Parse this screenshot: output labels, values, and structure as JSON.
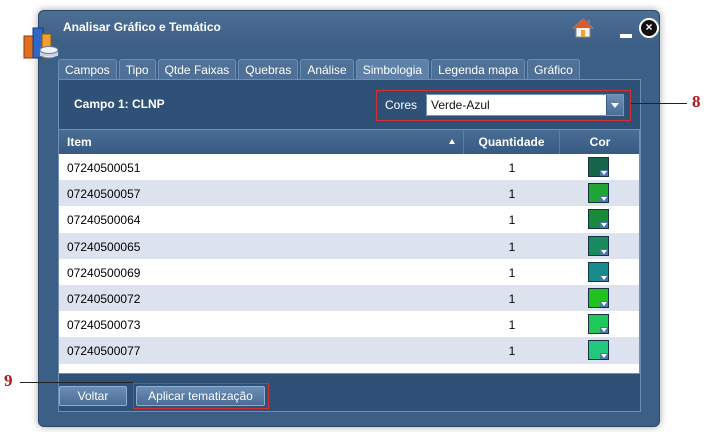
{
  "window": {
    "title": "Analisar Gráfico e Temático"
  },
  "tabs": [
    {
      "label": "Campos"
    },
    {
      "label": "Tipo"
    },
    {
      "label": "Qtde Faixas"
    },
    {
      "label": "Quebras"
    },
    {
      "label": "Análise"
    },
    {
      "label": "Simbologia",
      "active": true
    },
    {
      "label": "Legenda mapa"
    },
    {
      "label": "Gráfico"
    }
  ],
  "field": {
    "label": "Campo 1: CLNP"
  },
  "cores": {
    "label": "Cores",
    "value": "Verde-Azul"
  },
  "grid": {
    "headers": {
      "item": "Item",
      "quantidade": "Quantidade",
      "cor": "Cor"
    },
    "rows": [
      {
        "item": "07240500051",
        "quantidade": "1",
        "color": "#17664a"
      },
      {
        "item": "07240500057",
        "quantidade": "1",
        "color": "#1ea534"
      },
      {
        "item": "07240500064",
        "quantidade": "1",
        "color": "#1a8a3a"
      },
      {
        "item": "07240500065",
        "quantidade": "1",
        "color": "#188a5e"
      },
      {
        "item": "07240500069",
        "quantidade": "1",
        "color": "#178a8a"
      },
      {
        "item": "07240500072",
        "quantidade": "1",
        "color": "#22c21e"
      },
      {
        "item": "07240500073",
        "quantidade": "1",
        "color": "#20c85a"
      },
      {
        "item": "07240500077",
        "quantidade": "1",
        "color": "#22c87e"
      }
    ]
  },
  "buttons": {
    "back": "Voltar",
    "apply": "Aplicar tematização"
  },
  "annotations": {
    "cores": "8",
    "buttons": "9"
  },
  "colors": {
    "window_bg": "#3b5f86",
    "panel_bg": "#2f5178",
    "header_bg": "#4a6d94",
    "row_alt": "#dde3ee",
    "callout": "#d43030"
  }
}
